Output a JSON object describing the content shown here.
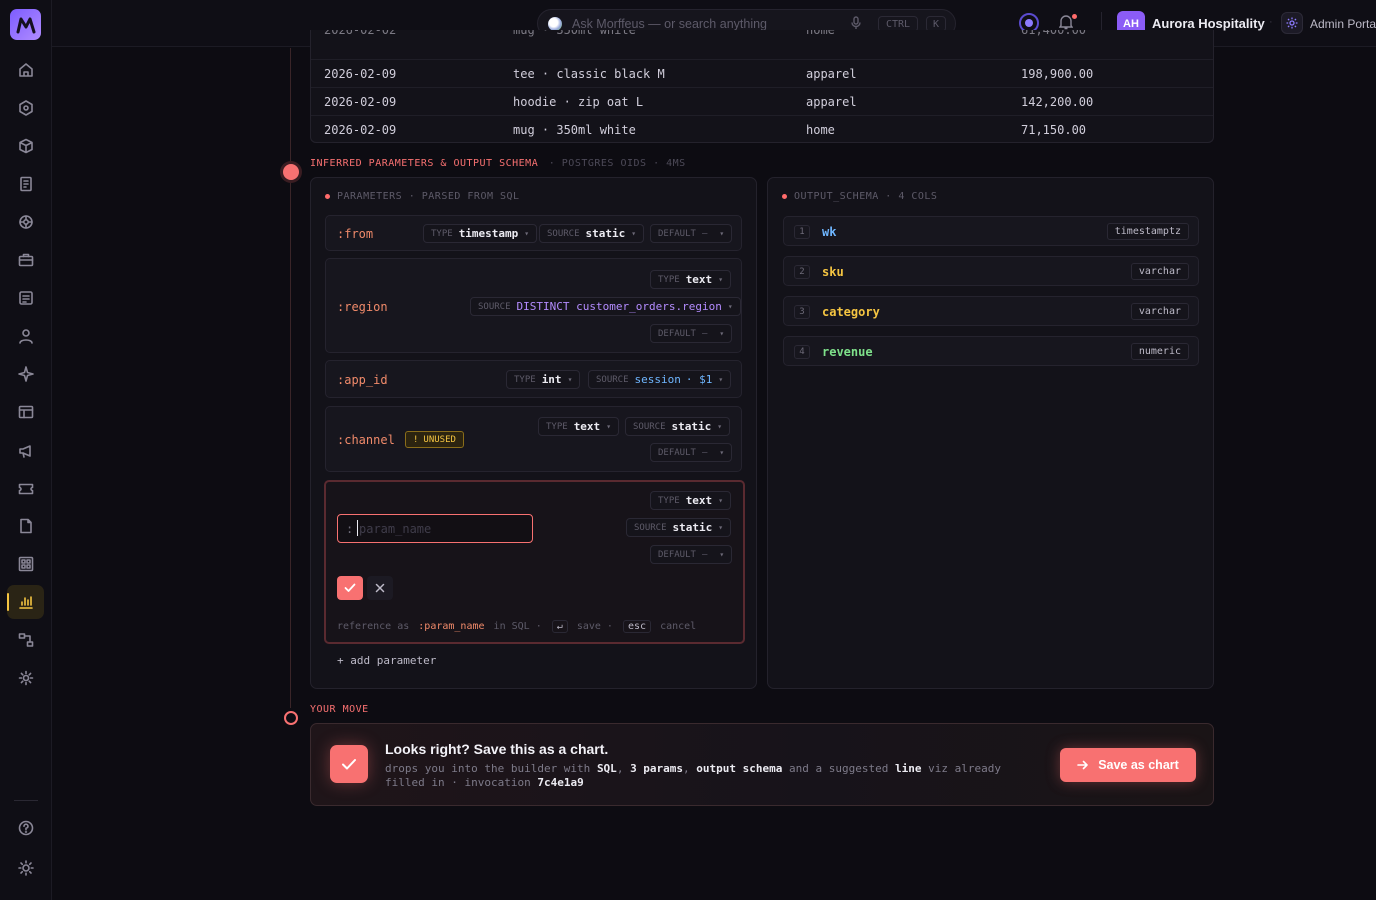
{
  "app": {
    "logo_letter": "m"
  },
  "topbar": {
    "search_placeholder": "Ask Morffeus — or search anything",
    "kbd_ctrl": "CTRL",
    "kbd_k": "K",
    "avatar_initials": "AH",
    "org_name": "Aurora Hospitality",
    "admin_label": "Admin Portal"
  },
  "table": {
    "rows": [
      {
        "date": "2026-02-09",
        "sku": "tee · classic black M",
        "category": "apparel",
        "revenue": "198,900.00"
      },
      {
        "date": "2026-02-09",
        "sku": "hoodie · zip oat L",
        "category": "apparel",
        "revenue": "142,200.00"
      },
      {
        "date": "2026-02-09",
        "sku": "mug · 350ml white",
        "category": "home",
        "revenue": "71,150.00"
      }
    ]
  },
  "section": {
    "title": "INFERRED PARAMETERS & OUTPUT SCHEMA",
    "meta": "· POSTGRES OIDS · 4MS"
  },
  "params": {
    "heading": "PARAMETERS · PARSED FROM SQL",
    "type_label": "TYPE",
    "source_label": "SOURCE",
    "default_label": "DEFAULT",
    "default_value": "—",
    "items": [
      {
        "name": ":from",
        "type": "timestamp",
        "source": "static"
      },
      {
        "name": ":region",
        "type": "text",
        "source": "DISTINCT customer_orders.region"
      },
      {
        "name": ":app_id",
        "type": "int",
        "source": "session",
        "source_extra": "· $1"
      },
      {
        "name": ":channel",
        "type": "text",
        "source": "static",
        "badge": "UNUSED"
      }
    ],
    "new_param": {
      "prefix": ":",
      "placeholder": "param_name",
      "type": "text",
      "source": "static",
      "hint_ref": "reference as",
      "hint_name": ":param_name",
      "hint_in": "in SQL ·",
      "hint_enter": "↵",
      "hint_save": "save ·",
      "hint_esc": "esc",
      "hint_cancel": "cancel"
    },
    "add_label": "+ add parameter"
  },
  "schema": {
    "heading": "OUTPUT_SCHEMA · 4 COLS",
    "cols": [
      {
        "n": "1",
        "name": "wk",
        "type": "timestamptz",
        "color": "#6fb6ff"
      },
      {
        "n": "2",
        "name": "sku",
        "type": "varchar",
        "color": "#f5c542"
      },
      {
        "n": "3",
        "name": "category",
        "type": "varchar",
        "color": "#f5c542"
      },
      {
        "n": "4",
        "name": "revenue",
        "type": "numeric",
        "color": "#7ee08a"
      }
    ]
  },
  "move": {
    "label": "YOUR MOVE",
    "title": "Looks right? Save this as a chart.",
    "body_1": "drops you into the builder with",
    "body_sql": "SQL",
    "body_params": "3 params",
    "body_schema": "output schema",
    "body_and": "and a suggested",
    "body_line": "line",
    "body_2": "viz already filled in · invocation",
    "invocation": "7c4e1a9",
    "button": "Save as chart"
  },
  "colors": {
    "accent": "#f87171",
    "active_nav": "#f5c542",
    "brand": "#8b5cf6"
  }
}
